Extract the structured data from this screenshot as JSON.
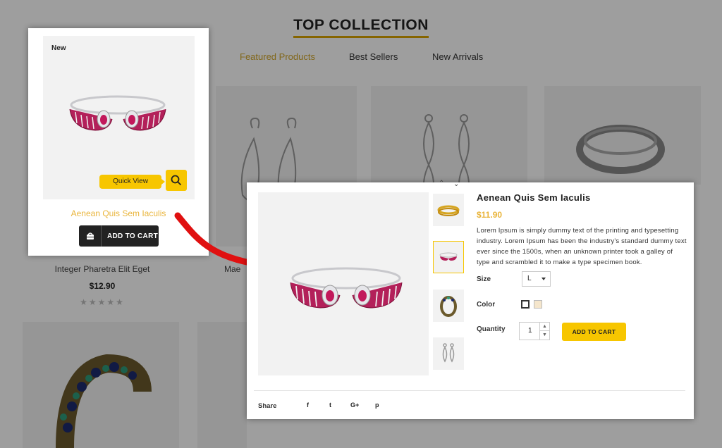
{
  "page": {
    "section_title": "TOP COLLECTION",
    "tabs": [
      {
        "label": "Featured Products",
        "active": true
      },
      {
        "label": "Best Sellers",
        "active": false
      },
      {
        "label": "New Arrivals",
        "active": false
      }
    ],
    "products": [
      {
        "name": "Integer Pharetra Elit Eget",
        "price": "$12.90",
        "stars": "★★★★★"
      },
      {
        "name": "Mae"
      }
    ]
  },
  "card": {
    "badge": "New",
    "quick_view_label": "Quick View",
    "title": "Aenean Quis Sem Iaculis",
    "add_to_cart": "ADD TO CART",
    "quick_view_icon": "search-icon",
    "cart_icon": "basket-icon"
  },
  "modal": {
    "title": "Aenean Quis Sem Iaculis",
    "price": "$11.90",
    "description": "Lorem Ipsum is simply dummy text of the printing and typesetting industry. Lorem Ipsum has been the industry's standard dummy text ever since the 1500s, when an unknown printer took a galley of type and scrambled it to make a type specimen book.",
    "size_label": "Size",
    "size_value": "L",
    "color_label": "Color",
    "colors": [
      "#ffffff",
      "#f5e6cc"
    ],
    "quantity_label": "Quantity",
    "quantity_value": "1",
    "add_to_cart": "ADD TO CART",
    "share_label": "Share",
    "social": [
      {
        "icon": "facebook-icon",
        "glyph": "f"
      },
      {
        "icon": "twitter-icon",
        "glyph": "t"
      },
      {
        "icon": "google-plus-icon",
        "glyph": "G+"
      },
      {
        "icon": "pinterest-icon",
        "glyph": "p"
      }
    ]
  },
  "colors": {
    "accent": "#f7c600",
    "title_gold": "#e9b43a",
    "dark_button": "#222222",
    "ruby": "#b3205a"
  }
}
